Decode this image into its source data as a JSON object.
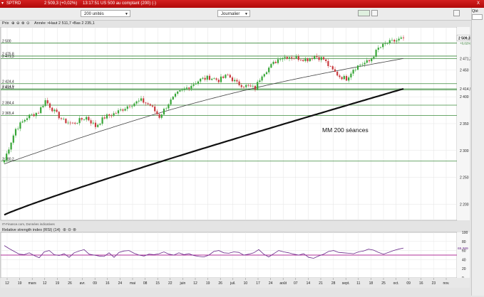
{
  "window": {
    "symbol": "SPTRD",
    "last": "2 509,3 (+0,02%)",
    "status": "13:17:51 US 500 au comptant (200) (-)",
    "close_label": "X"
  },
  "toolbar": {
    "units_value": "200 unités",
    "timeframe_value": "Journalier"
  },
  "side_panel": {
    "qty_label": "Qté"
  },
  "price_panel": {
    "label": "Prix",
    "info": "Année :•Haut 2 511,7 •Bas 2 235,1",
    "annotation": "MM 200 séances",
    "source": "IT-Finance.com, Données indicatives",
    "last_tag": "2 509,3",
    "change_tag": "+0,02%",
    "axis_ticks": [
      "2 450",
      "2 400",
      "2 350",
      "2 300",
      "2 250",
      "2 200"
    ]
  },
  "rsi_panel": {
    "label": "Relative strength index (RSI) (14)",
    "last_value": "65,369",
    "axis_ticks": [
      "100",
      "80",
      "60",
      "40",
      "20",
      "0"
    ]
  },
  "colors": {
    "up": "#37a637",
    "down": "#c8393d",
    "level": "#3a8a3a",
    "ma_long": "#111111",
    "ma_short": "#444444",
    "rsi": "#6a2a8a",
    "rsi_ref": "#b0309a",
    "title_bar": "#c01515"
  },
  "chart_data": [
    {
      "type": "candlestick",
      "title": "",
      "x_ticks": [
        "12",
        "19",
        "mars",
        "12",
        "19",
        "26",
        "avr.",
        "09",
        "16",
        "24",
        "mai",
        "08",
        "15",
        "22",
        "juin",
        "12",
        "19",
        "26",
        "juil.",
        "10",
        "17",
        "24",
        "août",
        "07",
        "14",
        "21",
        "28",
        "sept.",
        "11",
        "18",
        "25",
        "oct.",
        "09",
        "16",
        "23",
        "nov."
      ],
      "y_range": [
        2170,
        2530
      ],
      "levels": [
        {
          "label": "2 500",
          "value": 2500
        },
        {
          "label": "2 475,8",
          "value": 2475.8
        },
        {
          "label": "2 471,3",
          "value": 2471.3
        },
        {
          "label": "2 424,4",
          "value": 2424.4
        },
        {
          "label": "2 414,9",
          "value": 2414.9
        },
        {
          "label": "2 413,1",
          "value": 2413.1
        },
        {
          "label": "2 384,4",
          "value": 2384.4
        },
        {
          "label": "2 365,4",
          "value": 2365.4
        },
        {
          "label": "2 280,2",
          "value": 2280.2
        }
      ],
      "close_anchors": [
        [
          0,
          2282
        ],
        [
          5,
          2340
        ],
        [
          10,
          2362
        ],
        [
          15,
          2372
        ],
        [
          18,
          2393
        ],
        [
          22,
          2372
        ],
        [
          26,
          2355
        ],
        [
          30,
          2350
        ],
        [
          36,
          2362
        ],
        [
          40,
          2345
        ],
        [
          44,
          2362
        ],
        [
          49,
          2370
        ],
        [
          55,
          2385
        ],
        [
          60,
          2393
        ],
        [
          64,
          2384
        ],
        [
          68,
          2363
        ],
        [
          72,
          2388
        ],
        [
          76,
          2406
        ],
        [
          82,
          2422
        ],
        [
          86,
          2432
        ],
        [
          90,
          2436
        ],
        [
          94,
          2431
        ],
        [
          98,
          2440
        ],
        [
          102,
          2425
        ],
        [
          106,
          2420
        ],
        [
          110,
          2416
        ],
        [
          113,
          2442
        ],
        [
          117,
          2458
        ],
        [
          121,
          2474
        ],
        [
          125,
          2475
        ],
        [
          129,
          2472
        ],
        [
          133,
          2470
        ],
        [
          136,
          2476
        ],
        [
          140,
          2470
        ],
        [
          143,
          2453
        ],
        [
          147,
          2438
        ],
        [
          150,
          2434
        ],
        [
          153,
          2452
        ],
        [
          156,
          2460
        ],
        [
          160,
          2466
        ],
        [
          164,
          2490
        ],
        [
          168,
          2500
        ],
        [
          172,
          2505
        ],
        [
          175,
          2509.3
        ]
      ],
      "ma_long": {
        "name": "MM 200 séances",
        "start": 2180,
        "end": 2414.9
      },
      "ma_short": {
        "start": 2275,
        "end": 2471.3
      }
    },
    {
      "type": "line",
      "title": "Relative strength index (RSI) (14)",
      "y_range": [
        0,
        100
      ],
      "ref_level": 50,
      "values": [
        71,
        64,
        58,
        52,
        51,
        55,
        49,
        44,
        57,
        60,
        51,
        49,
        53,
        45,
        55,
        59,
        62,
        52,
        50,
        48,
        47,
        55,
        45,
        56,
        59,
        60,
        54,
        50,
        48,
        52,
        51,
        53,
        57,
        52,
        50,
        55,
        51,
        53,
        49,
        47,
        46,
        50,
        58,
        60,
        55,
        54,
        57,
        56,
        50,
        52,
        55,
        62,
        52,
        46,
        53,
        60,
        57,
        55,
        52,
        50,
        53,
        45,
        43,
        48,
        52,
        58,
        60,
        56,
        55,
        54,
        53,
        57,
        59,
        63,
        61,
        56,
        52,
        56,
        60,
        63,
        65.4
      ]
    }
  ]
}
